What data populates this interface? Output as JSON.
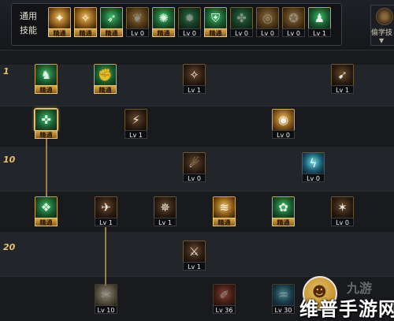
{
  "common": {
    "label": "通用技能",
    "slots": [
      {
        "icon": "kneel-icon",
        "tag": "精通",
        "mastered": true,
        "color": "gold"
      },
      {
        "icon": "flex-icon",
        "tag": "精通",
        "mastered": true,
        "color": "gold"
      },
      {
        "icon": "run-icon",
        "tag": "精通",
        "mastered": true,
        "color": "green"
      },
      {
        "icon": "wings-icon",
        "tag": "Lv 0",
        "mastered": false,
        "color": "gold"
      },
      {
        "icon": "compass-icon",
        "tag": "精通",
        "mastered": true,
        "color": "green"
      },
      {
        "icon": "star-burst-icon",
        "tag": "Lv 0",
        "mastered": false,
        "color": "green"
      },
      {
        "icon": "shield-icon",
        "tag": "精通",
        "mastered": true,
        "color": "green"
      },
      {
        "icon": "pose-icon",
        "tag": "Lv 0",
        "mastered": false,
        "color": "green"
      },
      {
        "icon": "target-icon",
        "tag": "Lv 0",
        "mastered": false,
        "color": "gold"
      },
      {
        "icon": "muscle-icon",
        "tag": "Lv 0",
        "mastered": false,
        "color": "gold"
      },
      {
        "icon": "stance-icon",
        "tag": "Lv 1",
        "mastered": false,
        "color": "green"
      }
    ]
  },
  "side_button": {
    "label": "偷学技",
    "icon": "steal-icon"
  },
  "levels": {
    "l1": "1",
    "l10": "10",
    "l20": "20"
  },
  "tree": {
    "row1": [
      {
        "icon": "spirit-icon",
        "tag": "精通",
        "mastered": true,
        "color": "green"
      },
      {
        "icon": "strike-icon",
        "tag": "精通",
        "mastered": true,
        "color": "green"
      },
      {
        "icon": "uppercut-icon",
        "tag": "Lv 1",
        "mastered": false,
        "color": "dark"
      },
      {
        "icon": "slide-icon",
        "tag": "Lv 1",
        "mastered": false,
        "color": "gold"
      }
    ],
    "row2": [
      {
        "icon": "sprint-icon",
        "tag": "精通",
        "mastered": true,
        "color": "green"
      },
      {
        "icon": "kick-icon",
        "tag": "Lv 1",
        "mastered": false,
        "color": "gold"
      },
      {
        "icon": "eye-icon",
        "tag": "Lv 0",
        "mastered": false,
        "color": "gold"
      }
    ],
    "row3": [
      {
        "icon": "dash-icon",
        "tag": "Lv 0",
        "mastered": false,
        "color": "gold"
      },
      {
        "icon": "lightning-icon",
        "tag": "Lv 0",
        "mastered": false,
        "color": "cyan"
      }
    ],
    "row4": [
      {
        "icon": "aura-icon",
        "tag": "精通",
        "mastered": true,
        "color": "green"
      },
      {
        "icon": "wing-strike-icon",
        "tag": "Lv 1",
        "mastered": false,
        "color": "dark"
      },
      {
        "icon": "dragon-icon",
        "tag": "Lv 1",
        "mastered": false,
        "color": "dark"
      },
      {
        "icon": "ground-slam-icon",
        "tag": "精通",
        "mastered": true,
        "color": "gold"
      },
      {
        "icon": "whirl-icon",
        "tag": "精通",
        "mastered": true,
        "color": "green"
      },
      {
        "icon": "spike-icon",
        "tag": "Lv 0",
        "mastered": false,
        "color": "dark"
      }
    ],
    "row5": [
      {
        "icon": "blade-icon",
        "tag": "Lv 1",
        "mastered": false,
        "color": "dark"
      }
    ],
    "row6": [
      {
        "icon": "scatter-icon",
        "tag": "Lv 10",
        "mastered": false,
        "color": "white"
      },
      {
        "icon": "claw-icon",
        "tag": "Lv 36",
        "mastered": false,
        "color": "red"
      },
      {
        "icon": "water-icon",
        "tag": "Lv 30",
        "mastered": false,
        "color": "cyan"
      }
    ]
  },
  "watermark": {
    "text": "维普手游网",
    "small": "九游"
  }
}
